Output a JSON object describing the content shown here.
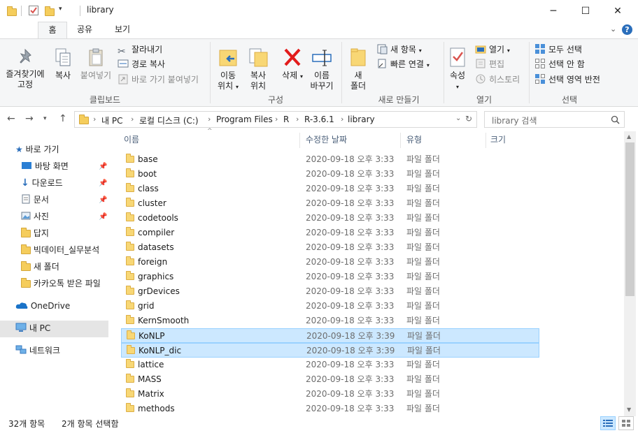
{
  "window": {
    "title": "library",
    "controls": {
      "minimize": "─",
      "maximize": "☐",
      "close": "✕"
    }
  },
  "ribbon_tabs": [
    "홈",
    "공유",
    "보기"
  ],
  "ribbon": {
    "clipboard": {
      "pin_label": [
        "즐겨찾기에",
        "고정"
      ],
      "copy_label": "복사",
      "paste_label": "붙여넣기",
      "cut_label": "잘라내기",
      "copy_path_label": "경로 복사",
      "paste_shortcut_label": "바로 가기 붙여넣기",
      "group": "클립보드"
    },
    "organize": {
      "move_label": [
        "이동",
        "위치"
      ],
      "copy_to_label": [
        "복사",
        "위치"
      ],
      "delete_label": "삭제",
      "rename_label": [
        "이름",
        "바꾸기"
      ],
      "group": "구성"
    },
    "new": {
      "new_folder_label": [
        "새",
        "폴더"
      ],
      "new_item_label": "새 항목",
      "easy_access_label": "빠른 연결",
      "group": "새로 만들기"
    },
    "open": {
      "properties_label": "속성",
      "open_label": "열기",
      "edit_label": "편집",
      "history_label": "히스토리",
      "group": "열기"
    },
    "select": {
      "select_all_label": "모두 선택",
      "select_none_label": "선택 안 함",
      "invert_label": "선택 영역 반전",
      "group": "선택"
    }
  },
  "address": {
    "crumbs": [
      "내 PC",
      "로컬 디스크 (C:)",
      "Program Files",
      "R",
      "R-3.6.1",
      "library"
    ],
    "search_placeholder": "library 검색"
  },
  "nav": {
    "quick_access": "바로 가기",
    "items": [
      "바탕 화면",
      "다운로드",
      "문서",
      "사진",
      "답지",
      "빅데이터_실무분석",
      "새 폴더",
      "카카오톡 받은 파일"
    ],
    "onedrive": "OneDrive",
    "this_pc": "내 PC",
    "network": "네트워크"
  },
  "columns": {
    "name": "이름",
    "modified": "수정한 날짜",
    "type": "유형",
    "size": "크기"
  },
  "files": [
    {
      "name": "base",
      "date": "2020-09-18 오후 3:33",
      "type": "파일 폴더",
      "selected": false
    },
    {
      "name": "boot",
      "date": "2020-09-18 오후 3:33",
      "type": "파일 폴더",
      "selected": false
    },
    {
      "name": "class",
      "date": "2020-09-18 오후 3:33",
      "type": "파일 폴더",
      "selected": false
    },
    {
      "name": "cluster",
      "date": "2020-09-18 오후 3:33",
      "type": "파일 폴더",
      "selected": false
    },
    {
      "name": "codetools",
      "date": "2020-09-18 오후 3:33",
      "type": "파일 폴더",
      "selected": false
    },
    {
      "name": "compiler",
      "date": "2020-09-18 오후 3:33",
      "type": "파일 폴더",
      "selected": false
    },
    {
      "name": "datasets",
      "date": "2020-09-18 오후 3:33",
      "type": "파일 폴더",
      "selected": false
    },
    {
      "name": "foreign",
      "date": "2020-09-18 오후 3:33",
      "type": "파일 폴더",
      "selected": false
    },
    {
      "name": "graphics",
      "date": "2020-09-18 오후 3:33",
      "type": "파일 폴더",
      "selected": false
    },
    {
      "name": "grDevices",
      "date": "2020-09-18 오후 3:33",
      "type": "파일 폴더",
      "selected": false
    },
    {
      "name": "grid",
      "date": "2020-09-18 오후 3:33",
      "type": "파일 폴더",
      "selected": false
    },
    {
      "name": "KernSmooth",
      "date": "2020-09-18 오후 3:33",
      "type": "파일 폴더",
      "selected": false
    },
    {
      "name": "KoNLP",
      "date": "2020-09-18 오후 3:39",
      "type": "파일 폴더",
      "selected": true
    },
    {
      "name": "KoNLP_dic",
      "date": "2020-09-18 오후 3:39",
      "type": "파일 폴더",
      "selected": true
    },
    {
      "name": "lattice",
      "date": "2020-09-18 오후 3:33",
      "type": "파일 폴더",
      "selected": false
    },
    {
      "name": "MASS",
      "date": "2020-09-18 오후 3:33",
      "type": "파일 폴더",
      "selected": false
    },
    {
      "name": "Matrix",
      "date": "2020-09-18 오후 3:33",
      "type": "파일 폴더",
      "selected": false
    },
    {
      "name": "methods",
      "date": "2020-09-18 오후 3:33",
      "type": "파일 폴더",
      "selected": false
    }
  ],
  "status": {
    "count": "32개 항목",
    "selected": "2개 항목 선택함"
  },
  "colors": {
    "selection_bg": "#cce8ff",
    "selection_border": "#99d1ff",
    "folder": "#f8d775",
    "accent": "#2a6ebb"
  }
}
